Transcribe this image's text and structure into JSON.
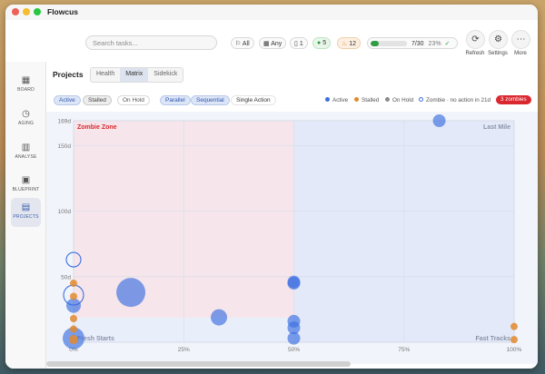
{
  "app": {
    "title": "Flowcus"
  },
  "window_controls": {
    "close_color": "#ee5f57",
    "minimize_color": "#f5bd2f",
    "maximize_color": "#27c840"
  },
  "search": {
    "placeholder": "Search tasks..."
  },
  "toolbar": {
    "filter_all": "All",
    "filter_any": "Any",
    "count_tasks": "1",
    "count_active": "5",
    "count_fire": "12",
    "progress_text": "7/30",
    "progress_percent": "23%",
    "progress_fraction": 0.23,
    "refresh_label": "Refresh",
    "settings_label": "Settings",
    "more_label": "More"
  },
  "sidebar": {
    "items": [
      {
        "label": "BOARD",
        "icon": "grid-icon"
      },
      {
        "label": "AGING",
        "icon": "clock-icon"
      },
      {
        "label": "ANALYSE",
        "icon": "bar-chart-icon"
      },
      {
        "label": "BLUEPRINT",
        "icon": "blueprint-icon"
      },
      {
        "label": "PROJECTS",
        "icon": "projects-icon"
      }
    ],
    "active": "PROJECTS"
  },
  "main": {
    "title": "Projects",
    "tabs": [
      "Health",
      "Matrix",
      "Sidekick"
    ],
    "active_tab": "Matrix",
    "filters": [
      "Active",
      "Stalled",
      "On Hold",
      "Parallel",
      "Sequential",
      "Single Action"
    ],
    "legend": [
      "Active",
      "Stalled",
      "On Hold",
      "Zombie · no action in 21d"
    ],
    "zombie_badge": "3 zombies"
  },
  "colors": {
    "active": "#3b6fe0",
    "stalled": "#e08a2e",
    "on_hold": "#8c8c8c",
    "zombie": "#d9282f",
    "accent": "#3b6fe0"
  },
  "chart_data": {
    "type": "scatter",
    "xlabel": "",
    "ylabel": "",
    "x_ticks": [
      "0%",
      "25%",
      "50%",
      "75%",
      "100%"
    ],
    "y_ticks": [
      "169d",
      "150d",
      "100d",
      "50d"
    ],
    "xlim": [
      0,
      100
    ],
    "ylim": [
      0,
      169
    ],
    "quadrant_labels": {
      "zombie": "Zombie Zone",
      "last_mile": "Last Mile",
      "fresh": "Fresh Starts",
      "fast": "Fast Tracks"
    },
    "points": [
      {
        "x": 83,
        "y": 169,
        "r": 7,
        "status": "active"
      },
      {
        "x": 13,
        "y": 38,
        "r": 16,
        "status": "active"
      },
      {
        "x": 33,
        "y": 19,
        "r": 9,
        "status": "active"
      },
      {
        "x": 50,
        "y": 45,
        "r": 7,
        "status": "active"
      },
      {
        "x": 50,
        "y": 46,
        "r": 7,
        "status": "active"
      },
      {
        "x": 50,
        "y": 16,
        "r": 7,
        "status": "active"
      },
      {
        "x": 50,
        "y": 11,
        "r": 7,
        "status": "active"
      },
      {
        "x": 50,
        "y": 3,
        "r": 7,
        "status": "active"
      },
      {
        "x": 0,
        "y": 28,
        "r": 8,
        "status": "active"
      },
      {
        "x": 0,
        "y": 3,
        "r": 12,
        "status": "active"
      },
      {
        "x": 0,
        "y": 63,
        "r": 8,
        "status": "active",
        "zombie": true
      },
      {
        "x": 0,
        "y": 36,
        "r": 11,
        "status": "active",
        "zombie": true
      },
      {
        "x": 0,
        "y": 45,
        "r": 4,
        "status": "stalled"
      },
      {
        "x": 0,
        "y": 35,
        "r": 4,
        "status": "stalled"
      },
      {
        "x": 0,
        "y": 18,
        "r": 4,
        "status": "stalled"
      },
      {
        "x": 0,
        "y": 10,
        "r": 4,
        "status": "stalled"
      },
      {
        "x": 0,
        "y": 2,
        "r": 5,
        "status": "stalled"
      },
      {
        "x": 100,
        "y": 12,
        "r": 4,
        "status": "stalled"
      },
      {
        "x": 100,
        "y": 2,
        "r": 4,
        "status": "stalled"
      }
    ]
  }
}
